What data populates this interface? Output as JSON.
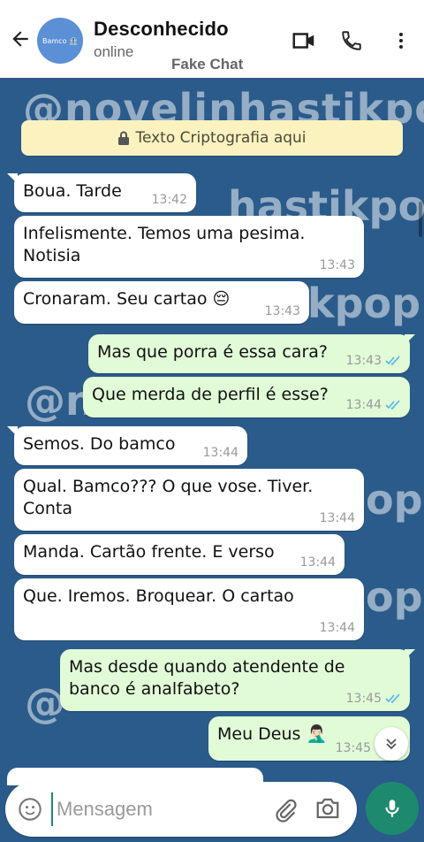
{
  "header": {
    "contact_name": "Desconhecido",
    "status": "online",
    "app_label": "Fake Chat",
    "avatar_text": "Bamco 🏦"
  },
  "watermark": "@novelinhastikpop",
  "encryption_notice": "Texto Criptografia aqui",
  "messages": [
    {
      "dir": "in",
      "text": "Boua.  Tarde",
      "time": "13:42"
    },
    {
      "dir": "in",
      "text": "Infelismente. Temos uma pesima.\nNotisia",
      "time": "13:43"
    },
    {
      "dir": "in",
      "text": "Cronaram. Seu cartao 😔",
      "time": "13:43"
    },
    {
      "dir": "out",
      "text": "Mas que porra é essa cara?",
      "time": "13:43"
    },
    {
      "dir": "out",
      "text": "Que merda de perfil é esse?",
      "time": "13:44"
    },
    {
      "dir": "in",
      "text": "Semos. Do bamco",
      "time": "13:44"
    },
    {
      "dir": "in",
      "text": "Qual. Bamco???  O que vose. Tiver.\nConta",
      "time": "13:44"
    },
    {
      "dir": "in",
      "text": "Manda. Cartão frente. E verso",
      "time": "13:44"
    },
    {
      "dir": "in",
      "text": "Que. Iremos. Broquear. O cartao",
      "time": "13:44"
    },
    {
      "dir": "out",
      "text": "Mas desde quando atendente de\nbanco é analfabeto?",
      "time": "13:45"
    },
    {
      "dir": "out",
      "text": "Meu Deus 🤦🏻‍♂️",
      "time": "13:45"
    }
  ],
  "input": {
    "placeholder": "Mensagem",
    "value": ""
  },
  "colors": {
    "chat_bg": "#2a5b8a",
    "incoming": "#ffffff",
    "outgoing": "#e1fbd7",
    "accent": "#1d8a6e",
    "read_ticks": "#4fb6ec"
  },
  "icons": [
    "back-arrow-icon",
    "video-call-icon",
    "phone-icon",
    "more-options-icon",
    "lock-icon",
    "double-check-icon",
    "chevron-down-icon",
    "emoji-icon",
    "attach-icon",
    "camera-icon",
    "mic-icon"
  ]
}
